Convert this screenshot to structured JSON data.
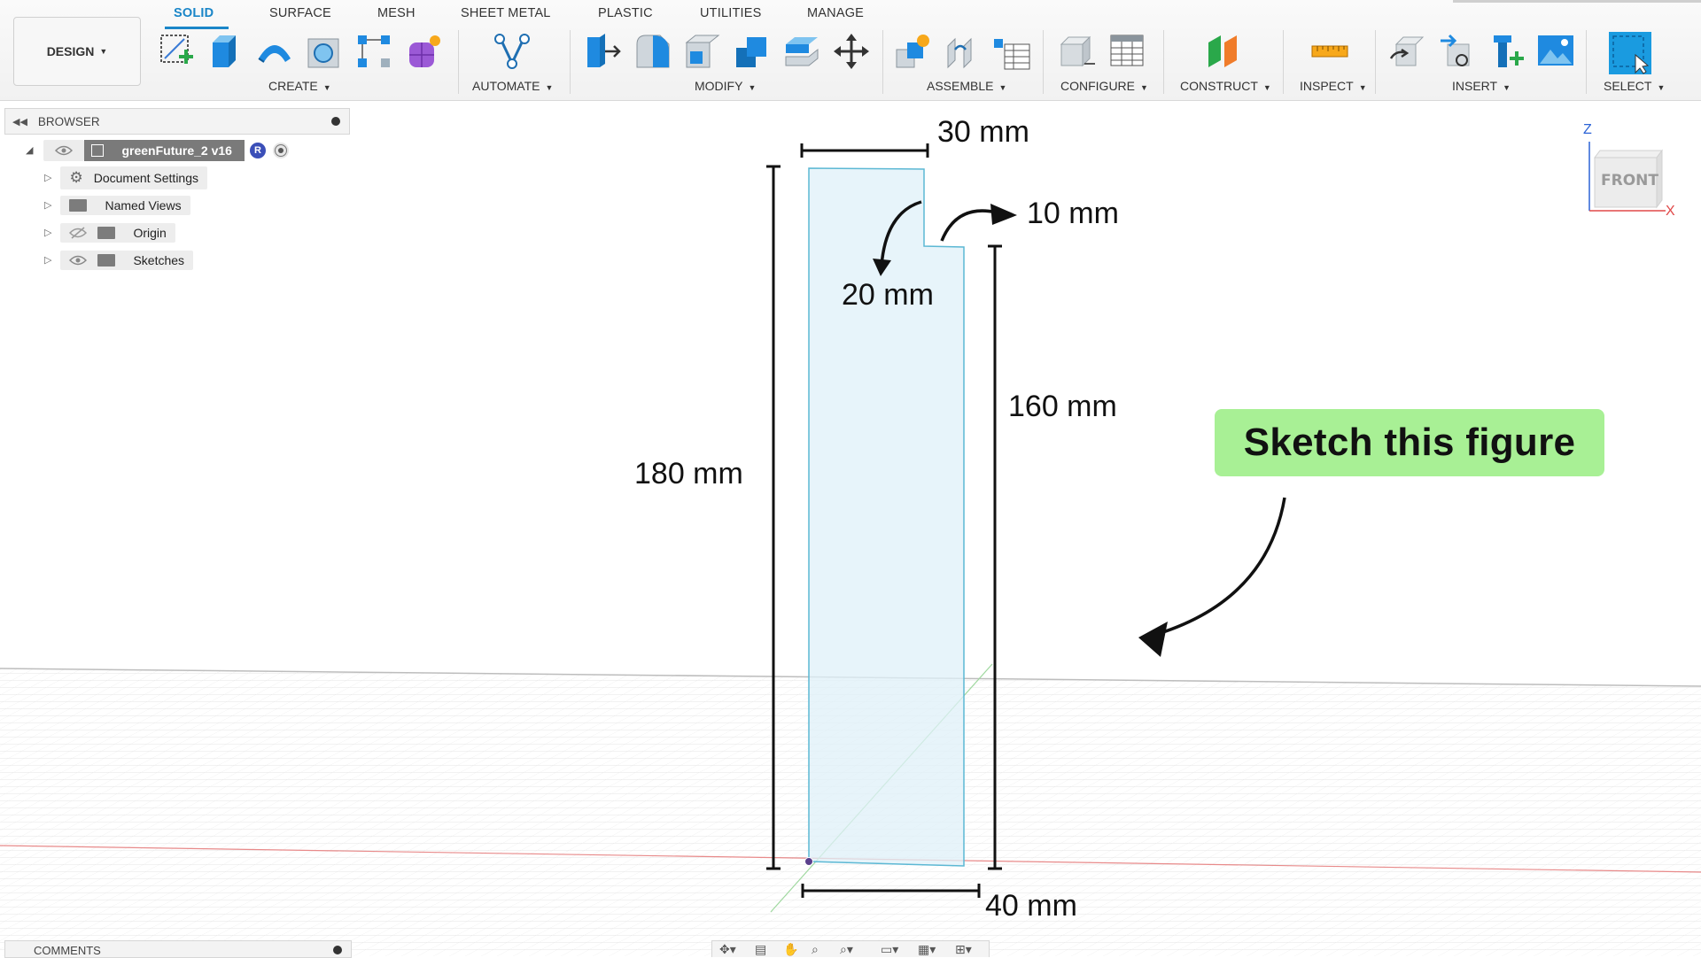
{
  "toolbar": {
    "workspace_label": "DESIGN",
    "tabs": [
      "SOLID",
      "SURFACE",
      "MESH",
      "SHEET METAL",
      "PLASTIC",
      "UTILITIES",
      "MANAGE"
    ],
    "groups": [
      "CREATE",
      "AUTOMATE",
      "MODIFY",
      "ASSEMBLE",
      "CONFIGURE",
      "CONSTRUCT",
      "INSPECT",
      "INSERT",
      "SELECT"
    ],
    "accent_color": "#1a86c8"
  },
  "browser": {
    "title": "BROWSER",
    "document_name": "greenFuture_2 v16",
    "badge": "R",
    "items": [
      "Document Settings",
      "Named Views",
      "Origin",
      "Sketches"
    ]
  },
  "viewcube": {
    "face": "FRONT",
    "axis_z": "Z",
    "axis_x": "X"
  },
  "annotations": {
    "dims": [
      "30 mm",
      "10 mm",
      "20 mm",
      "160 mm",
      "180 mm",
      "40 mm"
    ],
    "callout": "Sketch this figure",
    "callout_color": "#a8f095"
  },
  "comments": {
    "title": "COMMENTS"
  }
}
